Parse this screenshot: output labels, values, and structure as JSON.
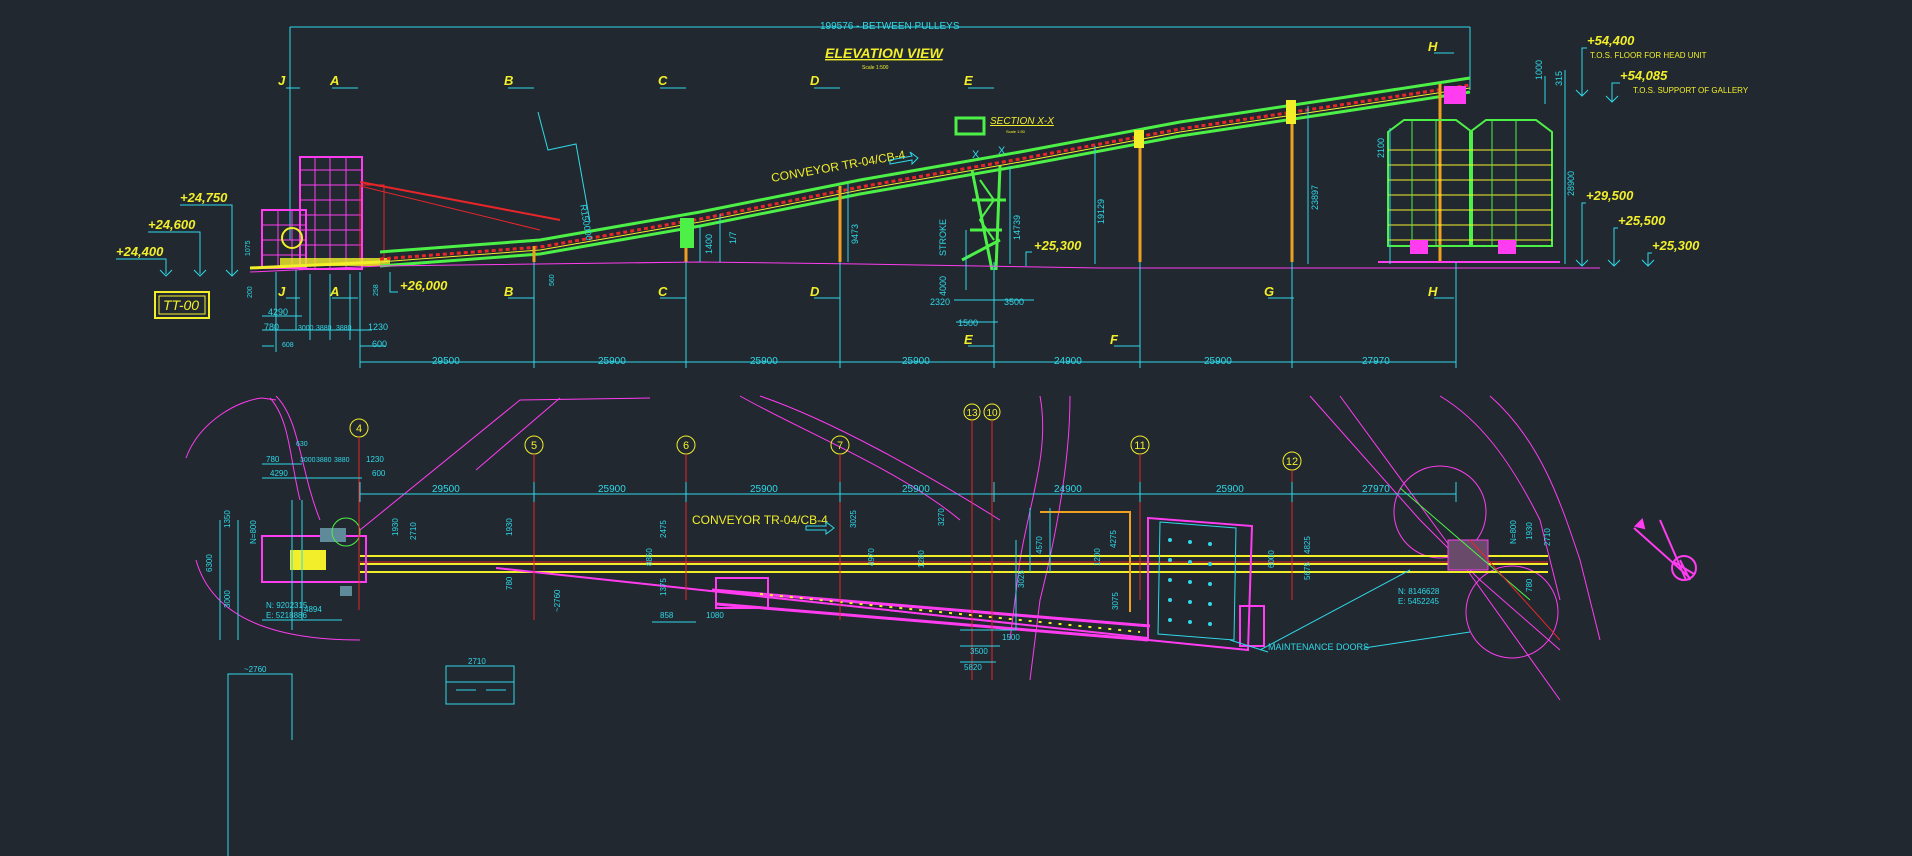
{
  "colors": {
    "background": "#212830",
    "cyan": "#2fd9e8",
    "yellow": "#f2ef2a",
    "magenta": "#ff3cf0",
    "green": "#4df046",
    "red": "#e8262a",
    "orange": "#f0a020"
  },
  "elevation": {
    "overall_dim": "199576 - BETWEEN PULLEYS",
    "title": "ELEVATION VIEW",
    "scale": "Scale 1:500",
    "conveyor_label": "CONVEYOR TR-04/CB-4",
    "section_label": "SECTION X-X",
    "section_scale": "Scale 1:50",
    "section_marks": [
      "X",
      "X"
    ],
    "radius_label": "R150000",
    "stroke_label": "STROKE",
    "levels_left": [
      "+24,750",
      "+24,600",
      "+24,400"
    ],
    "level_mid_1": "+26,000",
    "level_mid_2": "+25,300",
    "levels_right": [
      {
        "value": "+54,400",
        "note": "T.O.S. FLOOR FOR HEAD UNIT"
      },
      {
        "value": "+54,085",
        "note": "T.O.S. SUPPORT OF GALLERY"
      },
      {
        "value": "+29,500",
        "note": ""
      },
      {
        "value": "+25,500",
        "note": ""
      },
      {
        "value": "+25,300",
        "note": ""
      }
    ],
    "tag": "TT-00",
    "top_letters": [
      "J",
      "A",
      "B",
      "C",
      "D",
      "E",
      "H"
    ],
    "bottom_letters": [
      "J",
      "A",
      "B",
      "C",
      "D",
      "E",
      "F",
      "G",
      "H"
    ],
    "bay_dims": [
      "29500",
      "25900",
      "25900",
      "25900",
      "24900",
      "25900",
      "27970"
    ],
    "left_small_dims": [
      "4290",
      "780",
      "3000",
      "3880",
      "3880",
      "1230",
      "600",
      "608",
      "200",
      "1075",
      "258",
      "560"
    ],
    "heights": [
      "1400",
      "1/7",
      "9473",
      "14739",
      "19129",
      "23897",
      "2100",
      "28900",
      "1000",
      "315"
    ],
    "base_dims": [
      "2320",
      "3500",
      "1500",
      "4000"
    ]
  },
  "plan": {
    "conveyor_label": "CONVEYOR TR-04/CB-4",
    "grid_bubbles": [
      "4",
      "5",
      "6",
      "7",
      "13",
      "10",
      "11",
      "12"
    ],
    "bay_dims": [
      "29500",
      "25900",
      "25900",
      "25900",
      "24900",
      "25900",
      "27970"
    ],
    "coords_left": [
      "N: 9202315",
      "E: 5218886"
    ],
    "coords_right": [
      "N: 8146628",
      "E: 5452245"
    ],
    "maintenance": "MAINTENANCE DOORS",
    "dims_left": [
      "780",
      "4290",
      "3000",
      "3880",
      "3880",
      "1230",
      "600",
      "630",
      "1930",
      "2710",
      "1930",
      "4894",
      "6300",
      "3000",
      "1350",
      "780",
      "~2760",
      "858",
      "1080"
    ],
    "dims_mid": [
      "2475",
      "3025",
      "8850",
      "1375",
      "4970",
      "3270",
      "3025",
      "1280",
      "1500",
      "3500",
      "5820",
      "4275",
      "3075",
      "1200",
      "4570"
    ],
    "dims_right": [
      "6000",
      "4825",
      "5675",
      "1930",
      "2710",
      "780",
      "N=800",
      "N=800"
    ],
    "legend_dims": [
      "~2760",
      "2710"
    ]
  },
  "north_arrow": "north-arrow-icon"
}
